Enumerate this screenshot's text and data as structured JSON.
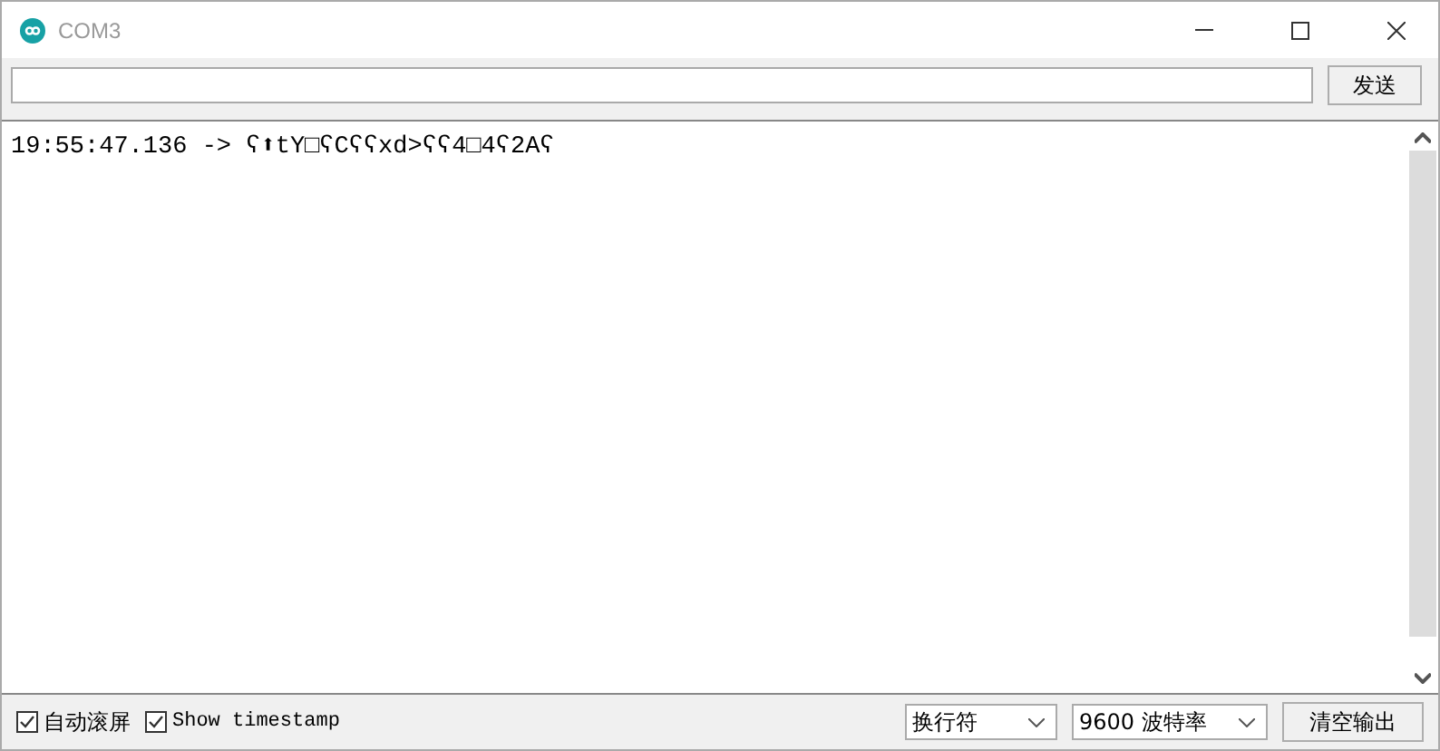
{
  "window": {
    "title": "COM3"
  },
  "send": {
    "button": "发送"
  },
  "output": {
    "lines": [
      "19:55:47.136 -> ʕ⬆tY□ʕCʕʕxd>ʕʕ4□4ʕ2Aʕ"
    ]
  },
  "footer": {
    "checkboxes": [
      {
        "label": "自动滚屏",
        "checked": true,
        "kind": "cjk"
      },
      {
        "label": "Show timestamp",
        "checked": true,
        "kind": "mono"
      }
    ],
    "line_ending": "换行符",
    "baud": "9600 波特率",
    "clear": "清空输出"
  }
}
